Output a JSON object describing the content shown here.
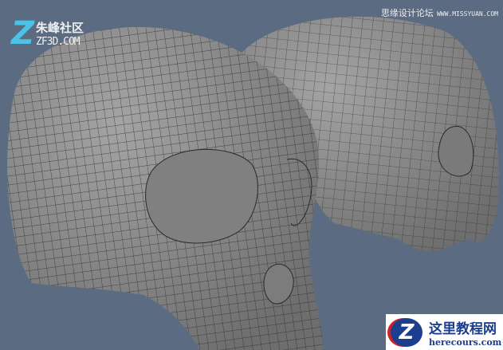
{
  "watermarks": {
    "top_left": {
      "logo": "Z",
      "name": "朱峰社区",
      "site": "ZF3D.COM"
    },
    "top_right": {
      "name": "思缘设计论坛",
      "site": "WWW.MISSYUAN.COM"
    },
    "bottom_right": {
      "logo": "Z",
      "name": "这里教程网",
      "site": "herecours.com"
    }
  },
  "colors": {
    "background": "#5b6b82",
    "mesh": "#8c8c8c",
    "wire": "#2a2a2a"
  }
}
